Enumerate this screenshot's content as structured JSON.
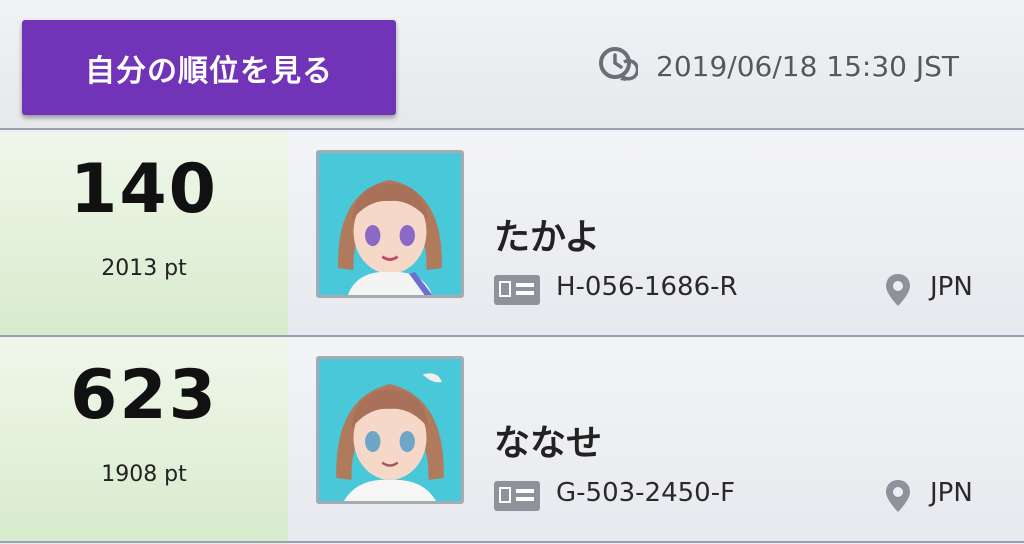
{
  "header": {
    "my_rank_button": "自分の順位を見る",
    "timestamp": "2019/06/18 15:30 JST"
  },
  "rows": [
    {
      "rank": "140",
      "points": "2013 pt",
      "name": "たかよ",
      "trainer_id": "H-056-1686-R",
      "region": "JPN"
    },
    {
      "rank": "623",
      "points": "1908 pt",
      "name": "ななせ",
      "trainer_id": "G-503-2450-F",
      "region": "JPN"
    }
  ],
  "colors": {
    "accent": "#7134b8",
    "rank_cell": "#d8ebcd",
    "avatar_bg": "#48c8d8"
  },
  "icons": {
    "timestamp": "clock-refresh-icon",
    "id": "id-card-icon",
    "region": "location-pin-icon"
  }
}
